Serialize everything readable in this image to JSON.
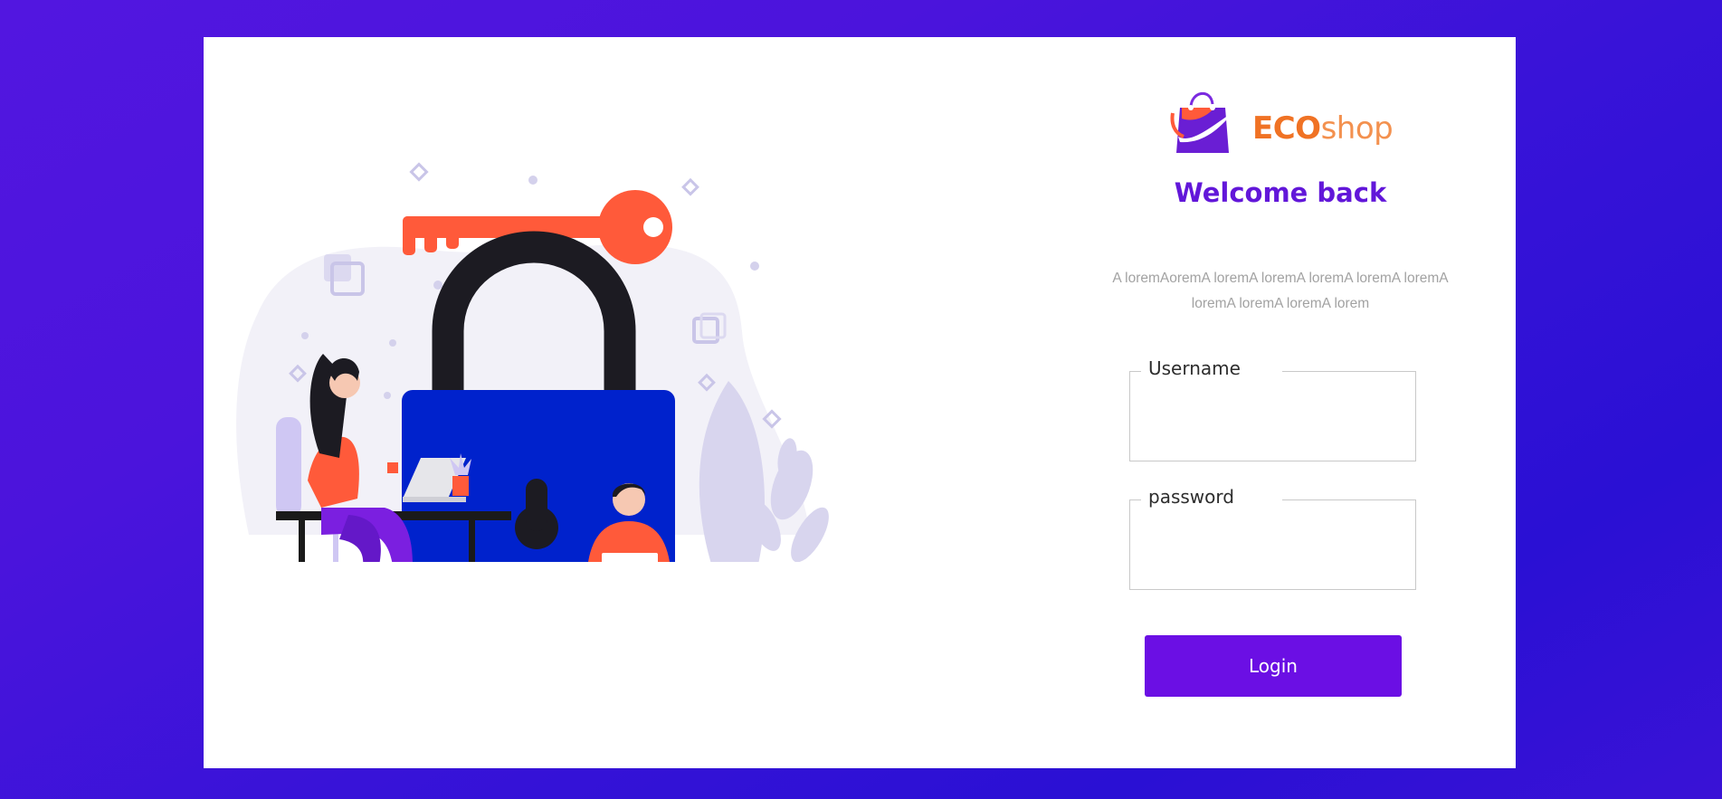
{
  "brand": {
    "name_primary": "ECO",
    "name_secondary": "shop",
    "logo_icon": "shopping-bag-icon",
    "colors": {
      "primary": "#6217d9",
      "orange": "#f07224"
    }
  },
  "login": {
    "title": "Welcome back",
    "subtitle": "A loremAoremA loremA loremA loremA loremA loremA loremA loremA loremA lorem",
    "username_label": "Username",
    "username_value": "",
    "password_label": "password",
    "password_value": "",
    "login_button": "Login"
  },
  "illustration": {
    "subject": "security-lock-illustration"
  },
  "colors": {
    "page_gradient_start": "#5216e0",
    "page_gradient_end": "#2a10d4",
    "card": "#ffffff",
    "button": "#6b0fe4",
    "title": "#6217d9"
  }
}
